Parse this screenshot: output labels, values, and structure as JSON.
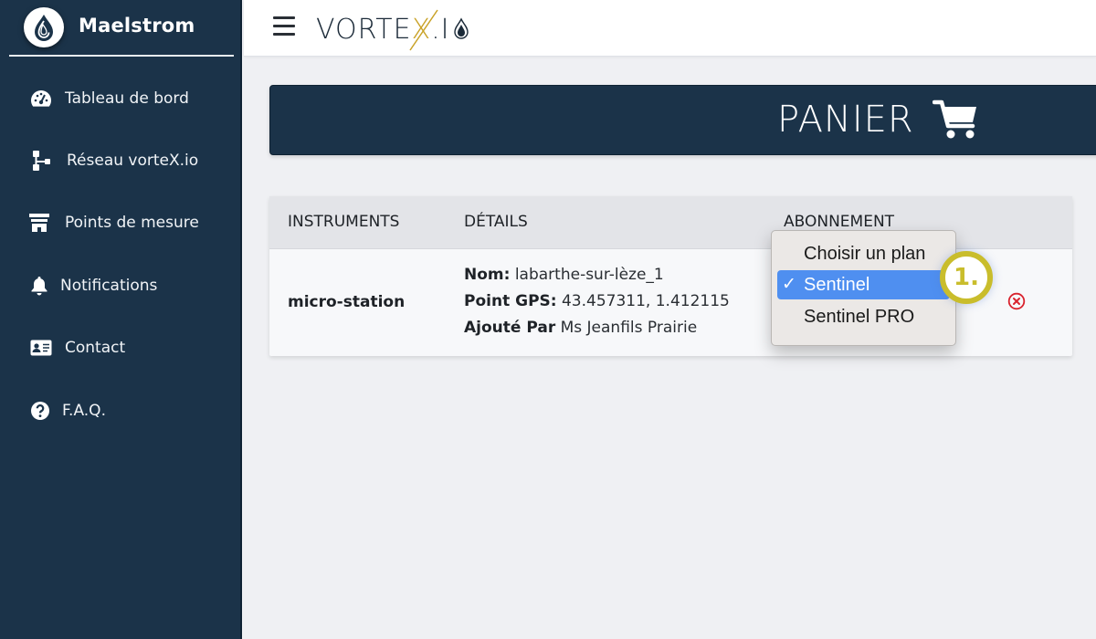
{
  "sidebar": {
    "brand": "Maelstrom",
    "items": [
      {
        "label": "Tableau de bord",
        "icon": "gauge-icon"
      },
      {
        "label": "Réseau vorteX.io",
        "icon": "network-icon"
      },
      {
        "label": "Points de mesure",
        "icon": "measure-point-icon"
      },
      {
        "label": "Notifications",
        "icon": "bell-icon"
      },
      {
        "label": "Contact",
        "icon": "contact-card-icon"
      },
      {
        "label": "F.A.Q.",
        "icon": "question-icon"
      }
    ]
  },
  "topbar": {
    "logo_pre": "VORTE",
    "logo_x": "X",
    "logo_post": ".I"
  },
  "page": {
    "title": "PANIER"
  },
  "table": {
    "headers": {
      "instruments": "INSTRUMENTS",
      "details": "DÉTAILS",
      "subscription": "ABONNEMENT"
    },
    "rows": [
      {
        "instrument": "micro-station",
        "details": {
          "name_label": "Nom:",
          "name_value": "labarthe-sur-lèze_1",
          "gps_label": "Point GPS:",
          "gps_value": "43.457311, 1.412115",
          "added_label": "Ajouté Par",
          "added_value": "Ms Jeanfils Prairie"
        }
      }
    ]
  },
  "dropdown": {
    "options": [
      "Choisir un plan",
      "Sentinel",
      "Sentinel PRO"
    ],
    "selected": "Sentinel",
    "check": "✓"
  },
  "annotation": {
    "marker_label": "1."
  },
  "colors": {
    "sidebar_bg": "#1b3349",
    "accent_gold": "#c9a227",
    "selection_blue": "#4f8ff0",
    "remove_red": "#d9232e",
    "marker_yellow": "#c9bd2c"
  }
}
